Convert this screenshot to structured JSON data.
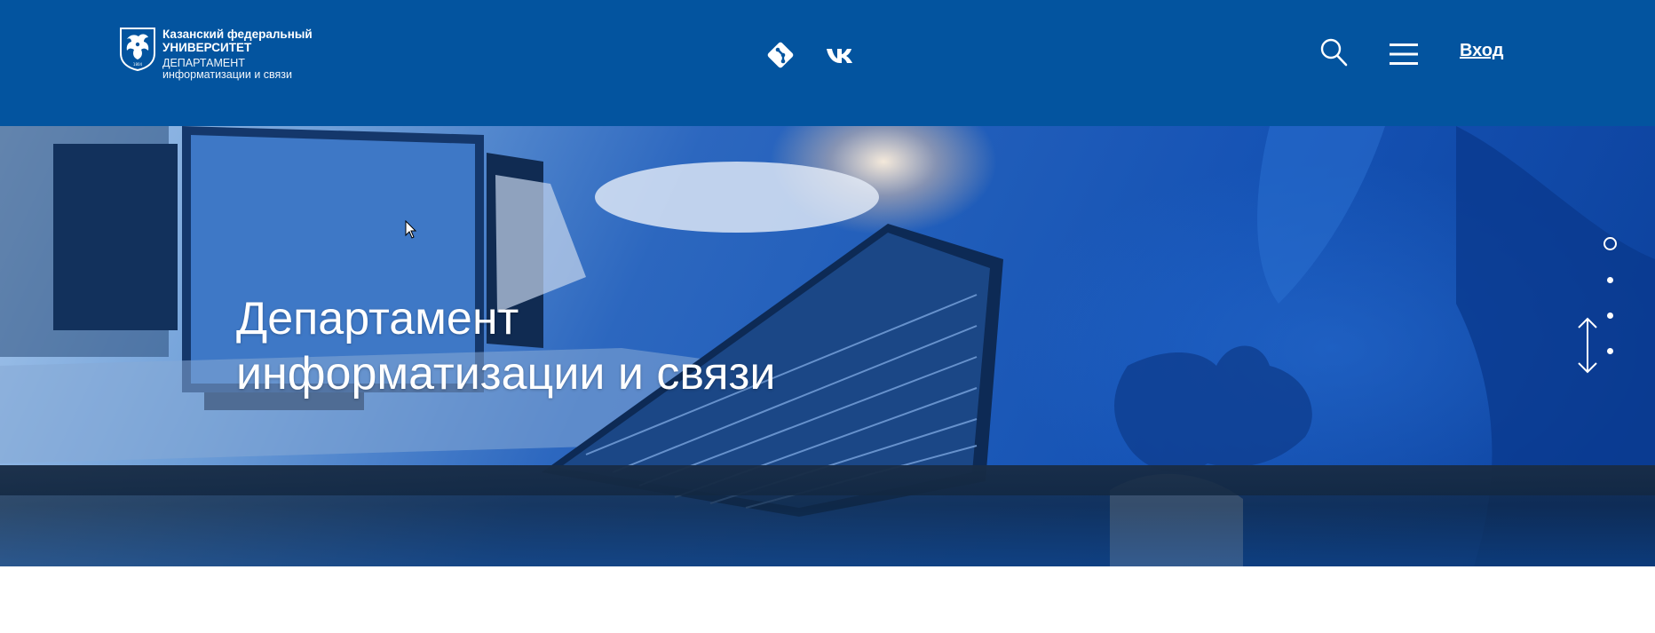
{
  "header": {
    "logo": {
      "line1": "Казанский федеральный",
      "line2": "УНИВЕРСИТЕТ",
      "line3": "ДЕПАРТАМЕНТ",
      "line4": "информатизации и связи",
      "emblem_icon": "kfu-emblem-icon"
    },
    "social": [
      {
        "name": "git",
        "icon": "git-icon"
      },
      {
        "name": "vk",
        "icon": "vk-icon"
      }
    ],
    "search_icon": "search-icon",
    "menu_icon": "hamburger-menu-icon",
    "login_label": "Вход"
  },
  "hero": {
    "title_line1": "Департамент",
    "title_line2": "информатизации и связи",
    "slider": {
      "total": 4,
      "active_index": 0
    },
    "scroll_icon": "scroll-up-down-icon"
  },
  "colors": {
    "header_bg": "#03549f",
    "text": "#ffffff"
  }
}
